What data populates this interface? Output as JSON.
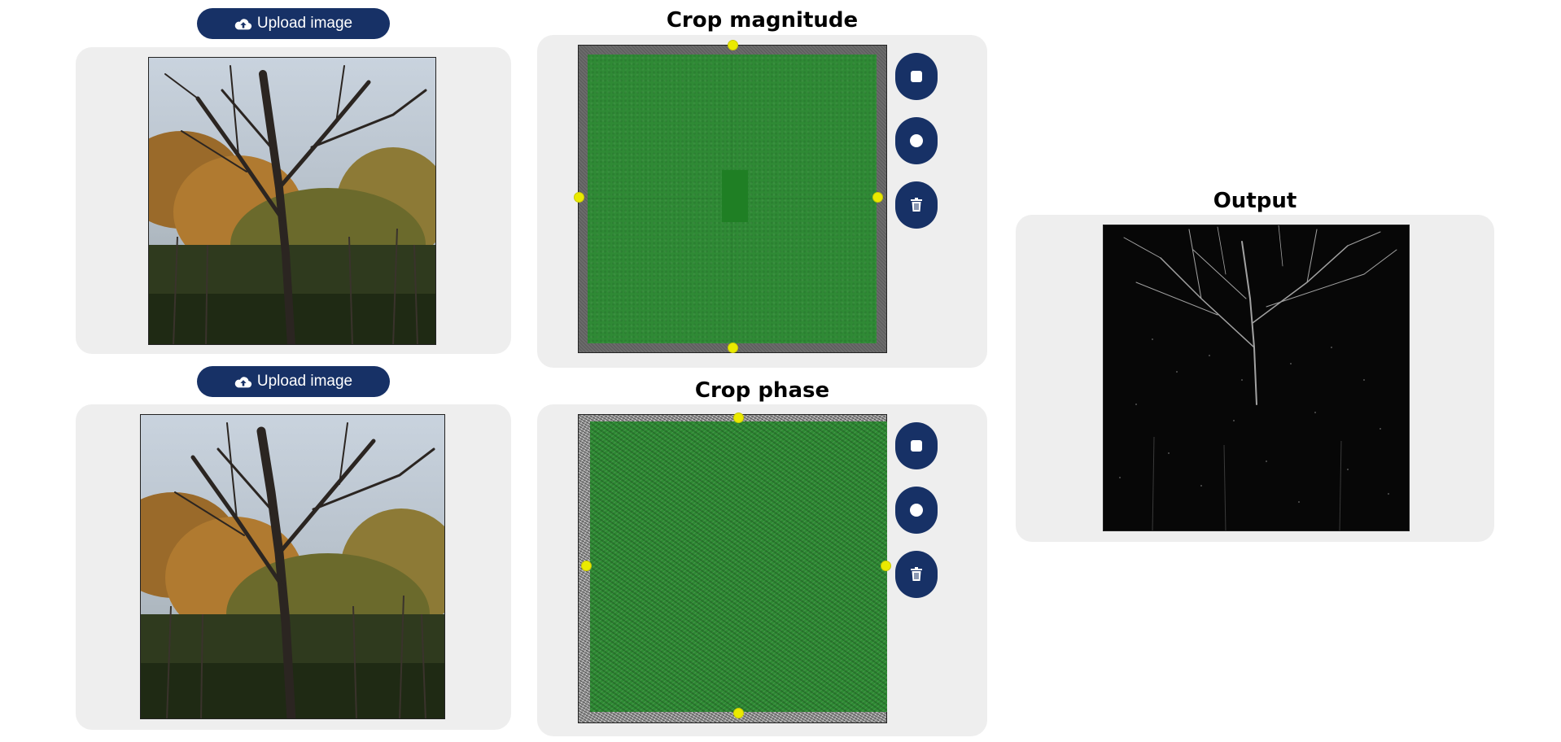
{
  "inputs": [
    {
      "upload_label": "Upload image"
    },
    {
      "upload_label": "Upload image"
    }
  ],
  "magnitude": {
    "title": "Crop magnitude"
  },
  "phase": {
    "title": "Crop phase"
  },
  "output": {
    "title": "Output"
  },
  "tools": [
    "square-select-icon",
    "circle-select-icon",
    "trash-icon"
  ],
  "colors": {
    "accent": "#173166",
    "panel": "#eeeeee",
    "handle": "#eaea00",
    "field_green": "#2f8a35"
  }
}
